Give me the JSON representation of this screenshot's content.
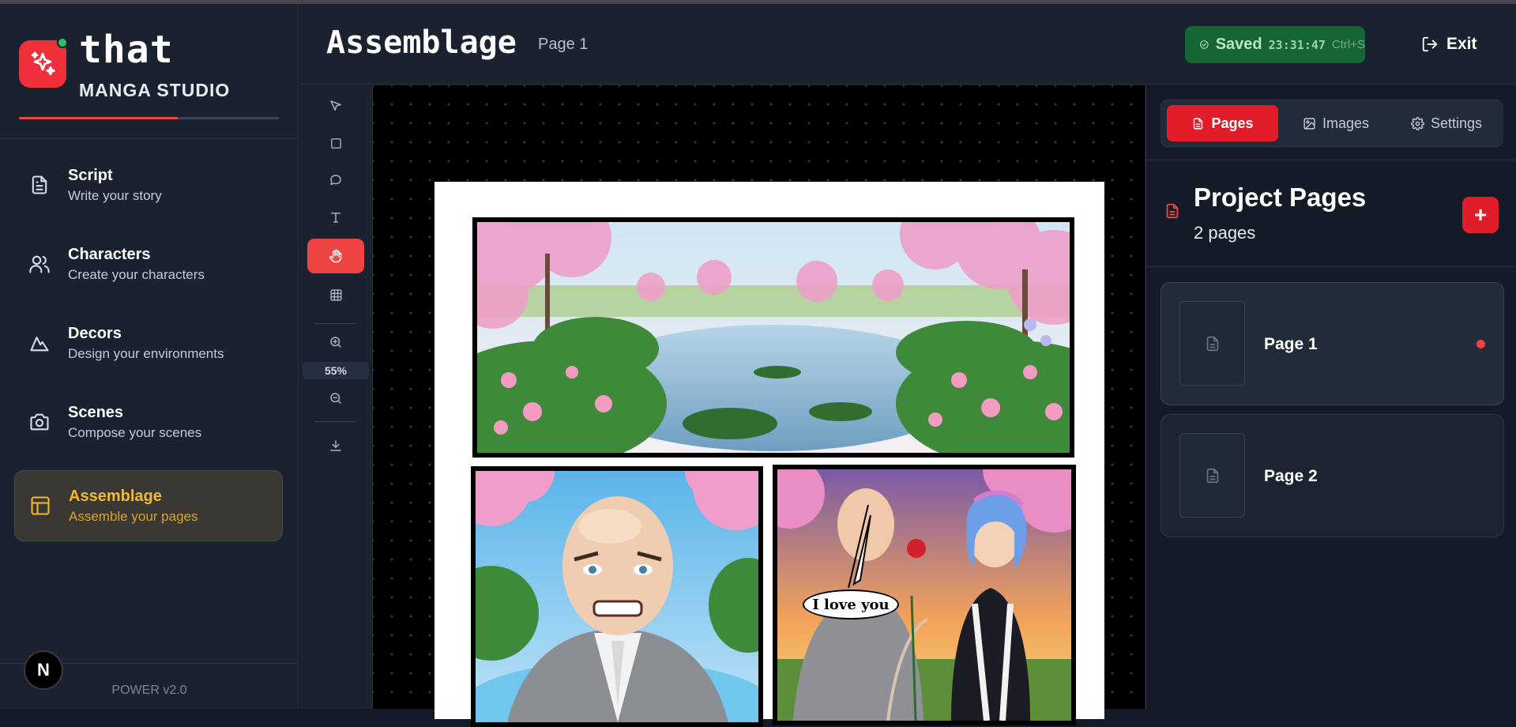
{
  "brand": {
    "title": "that",
    "subtitle": "MANGA STUDIO",
    "progress": 0.61
  },
  "nav": [
    {
      "label": "Script",
      "sub": "Write your story",
      "icon": "document-icon"
    },
    {
      "label": "Characters",
      "sub": "Create your characters",
      "icon": "users-icon"
    },
    {
      "label": "Decors",
      "sub": "Design your environments",
      "icon": "mountain-icon"
    },
    {
      "label": "Scenes",
      "sub": "Compose your scenes",
      "icon": "camera-icon"
    },
    {
      "label": "Assemblage",
      "sub": "Assemble your pages",
      "icon": "layout-icon",
      "active": true
    }
  ],
  "footer": {
    "badge": "N",
    "version": "POWER v2.0"
  },
  "header": {
    "title": "Assemblage",
    "page": "Page 1",
    "saved_label": "Saved",
    "saved_time": "23:31:47",
    "saved_shortcut": "Ctrl+S",
    "exit_label": "Exit"
  },
  "tools": {
    "zoom": "55%",
    "items": [
      "select",
      "rectangle",
      "speech-bubble",
      "text",
      "pan",
      "grid",
      "zoom-in",
      "zoom-out",
      "download"
    ],
    "active": "pan"
  },
  "canvas": {
    "bubble_text": "I love you"
  },
  "right_panel": {
    "tabs": [
      {
        "label": "Pages",
        "icon": "file-icon",
        "active": true
      },
      {
        "label": "Images",
        "icon": "image-icon"
      },
      {
        "label": "Settings",
        "icon": "gear-icon"
      }
    ],
    "title": "Project Pages",
    "count": "2 pages",
    "add_label": "+",
    "pages": [
      {
        "label": "Page 1",
        "selected": true
      },
      {
        "label": "Page 2",
        "selected": false
      }
    ]
  },
  "colors": {
    "accent_red": "#ef4444",
    "active_gold": "#f5b82e",
    "saved_green": "#166534"
  }
}
